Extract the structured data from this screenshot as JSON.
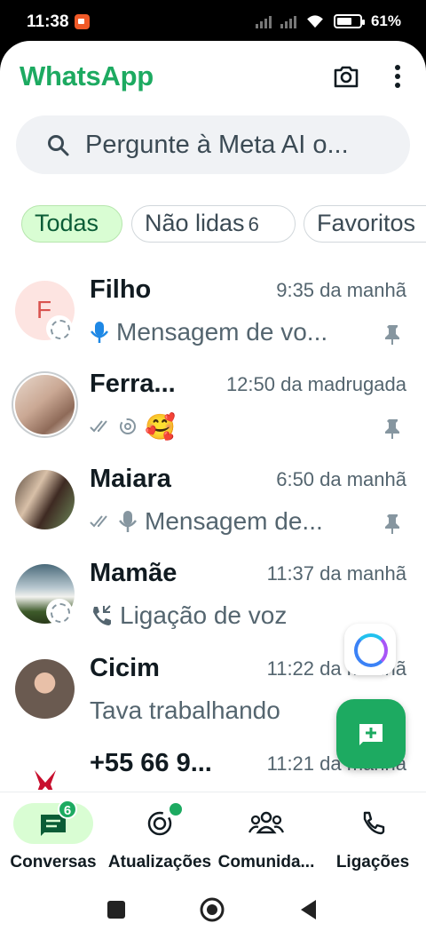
{
  "status_bar": {
    "time": "11:38",
    "battery": "61%",
    "icons": [
      "recording-icon",
      "signal-icon",
      "wifi-icon",
      "battery-icon"
    ]
  },
  "header": {
    "title": "WhatsApp",
    "icons": [
      "camera-icon",
      "more-vert-icon"
    ]
  },
  "search": {
    "placeholder": "Pergunte à Meta AI o..."
  },
  "filters": [
    {
      "label": "Todas",
      "active": true
    },
    {
      "label": "Não lidas",
      "count": "6",
      "active": false
    },
    {
      "label": "Favoritos",
      "active": false
    }
  ],
  "chats": [
    {
      "name": "Filho",
      "time": "9:35 da manhã",
      "preview": "Mensagem de vo...",
      "preview_icon": "mic-icon",
      "pinned": true,
      "avatar_letter": "F"
    },
    {
      "name": "Ferra...",
      "time": "12:50 da madrugada",
      "preview": "🥰",
      "preview_icon": "double-check-icon",
      "pinned": true
    },
    {
      "name": "Maiara",
      "time": "6:50 da manhã",
      "preview": "Mensagem de...",
      "preview_icon": "mic-icon",
      "pinned": true
    },
    {
      "name": "Mamãe",
      "time": "11:37 da manhã",
      "preview": "Ligação de voz",
      "preview_icon": "call-icon",
      "pinned": false
    },
    {
      "name": "Cicim",
      "time": "11:22 da manhã",
      "preview": "Tava trabalhando",
      "pinned": false
    },
    {
      "name": "+55 66 9...",
      "time": "11:21 da manhã",
      "preview": "",
      "pinned": false
    }
  ],
  "bottom_nav": [
    {
      "label": "Conversas",
      "badge": "6",
      "active": true,
      "icon": "chats-icon"
    },
    {
      "label": "Atualizações",
      "active": false,
      "icon": "updates-icon"
    },
    {
      "label": "Comunida...",
      "active": false,
      "icon": "communities-icon"
    },
    {
      "label": "Ligações",
      "active": false,
      "icon": "calls-icon"
    }
  ],
  "colors": {
    "brand": "#1daa61",
    "chip_active_bg": "#d9fdd3",
    "text_secondary": "#54656f"
  }
}
